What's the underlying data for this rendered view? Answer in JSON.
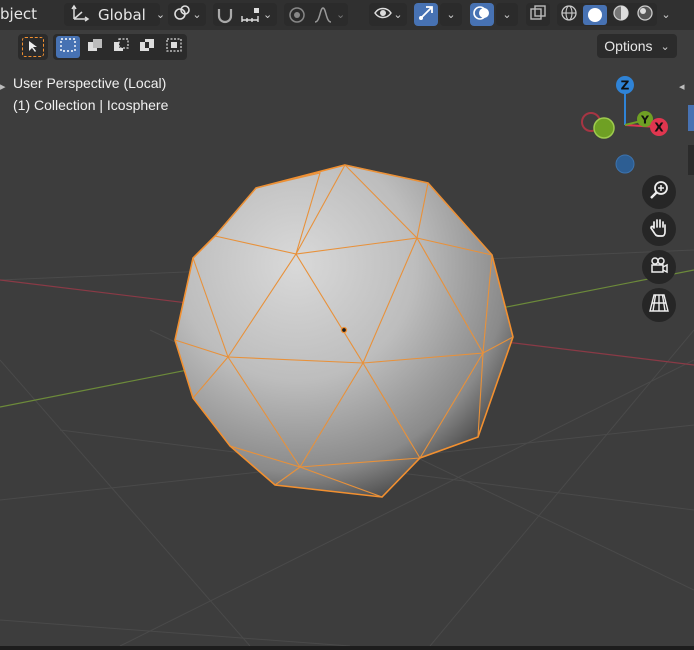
{
  "header": {
    "mode_label": "bject",
    "orientation_label": "Global",
    "options_label": "Options"
  },
  "viewport": {
    "view_name": "User Perspective (Local)",
    "collection_line": "(1) Collection | Icosphere"
  },
  "gizmo": {
    "z_label": "Z",
    "y_label": "Y",
    "x_label": "X",
    "colors": {
      "x": "#e0364f",
      "y": "#6fa024",
      "z": "#2f83d6"
    }
  },
  "icons": {
    "transform_orientation": "axes-icon",
    "pivot": "link-icon",
    "snap": "magnet-icon",
    "snap_target": "increment-icon",
    "proportional": "circle-dot-icon",
    "falloff": "falloff-curve-icon",
    "visibility": "eye-icon",
    "gizmos": "gizmo-arrow-icon",
    "overlays": "overlay-circles-icon",
    "xray": "xray-icon",
    "shading": [
      "wireframe-icon",
      "solid-icon",
      "material-icon",
      "rendered-icon"
    ],
    "nav": [
      "zoom-icon",
      "pan-hand-icon",
      "camera-icon",
      "grid-perspective-icon"
    ]
  },
  "colors": {
    "selection": "#f29030",
    "accent": "#4772b3",
    "background": "#3d3d3d"
  }
}
